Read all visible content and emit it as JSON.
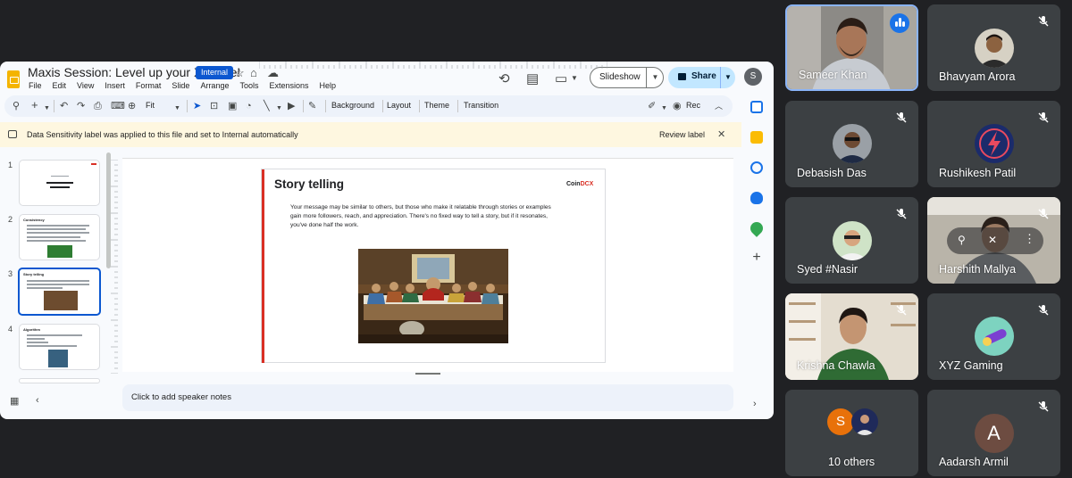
{
  "slides": {
    "title": "Maxis Session: Level up your X game!",
    "badge": "Internal",
    "menu": [
      "File",
      "Edit",
      "View",
      "Insert",
      "Format",
      "Slide",
      "Arrange",
      "Tools",
      "Extensions",
      "Help"
    ],
    "slideshow_label": "Slideshow",
    "share_label": "Share",
    "account_initial": "S",
    "toolbar": {
      "zoom": "Fit",
      "background": "Background",
      "layout": "Layout",
      "theme": "Theme",
      "transition": "Transition",
      "rec": "Rec"
    },
    "banner": {
      "text": "Data Sensitivity label was applied to this file and set to Internal automatically",
      "review": "Review label"
    },
    "thumbnails": [
      {
        "num": "1",
        "title": "Level up your X game 2.0"
      },
      {
        "num": "2",
        "title": "Consistency"
      },
      {
        "num": "3",
        "title": "Story telling"
      },
      {
        "num": "4",
        "title": "Algorithm"
      }
    ],
    "current_slide": {
      "title": "Story telling",
      "logo_a": "Coin",
      "logo_b": "DCX",
      "body": "Your message may be similar to others, but those who make it relatable through stories or examples gain more followers, reach, and appreciation. There's no fixed way to tell a story, but if it resonates, you've done half the work."
    },
    "notes_placeholder": "Click to add speaker notes"
  },
  "meet": {
    "participants": [
      {
        "name": "Sameer Khan"
      },
      {
        "name": "Bhavyam Arora"
      },
      {
        "name": "Debasish Das"
      },
      {
        "name": "Rushikesh Patil"
      },
      {
        "name": "Syed #Nasir"
      },
      {
        "name": "Harshith Mallya"
      },
      {
        "name": "Krishna Chawla"
      },
      {
        "name": "XYZ Gaming"
      },
      {
        "name": "10 others",
        "initial": "S"
      },
      {
        "name": "Aadarsh Armil",
        "initial": "A"
      }
    ]
  },
  "colors": {
    "accent": "#0b57d0",
    "banner": "#fef7e0",
    "tile": "#3c4043",
    "speaking": "#1a73e8"
  }
}
